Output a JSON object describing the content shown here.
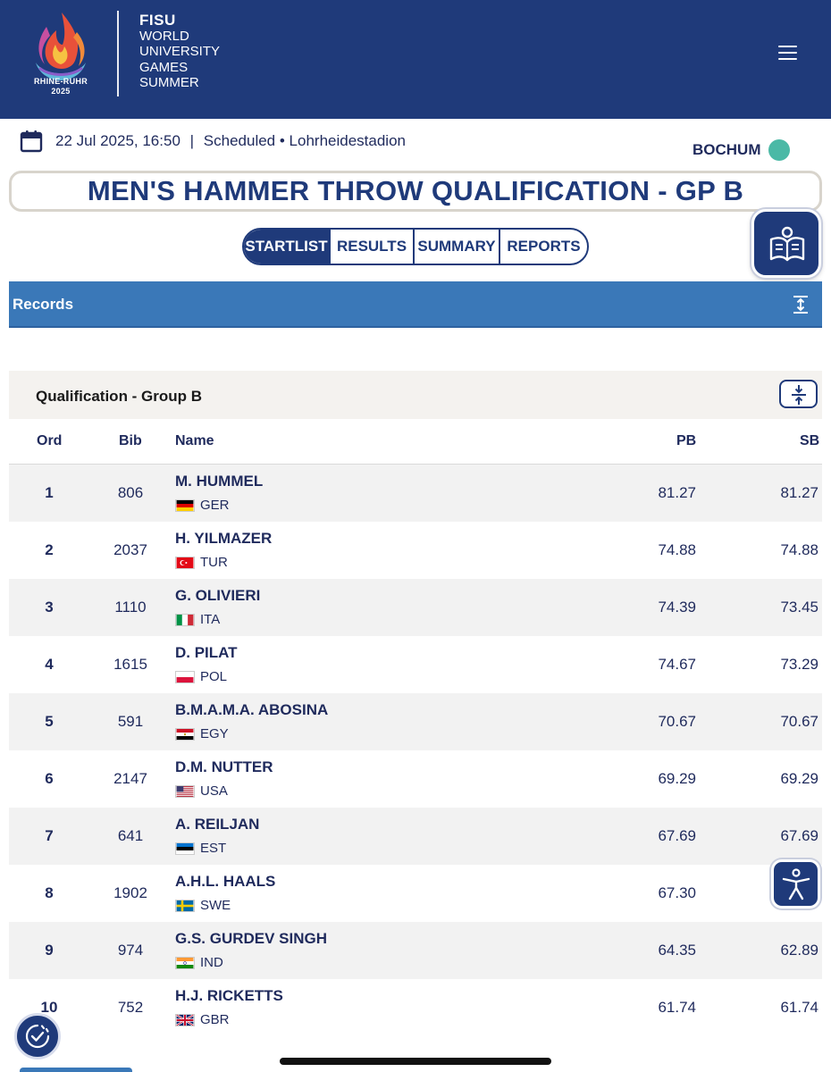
{
  "header": {
    "logo_caption_line1": "RHINE-RUHR",
    "logo_caption_line2": "2025",
    "brand_lines": [
      "FISU",
      "WORLD",
      "UNIVERSITY",
      "GAMES",
      "SUMMER"
    ],
    "menu_icon": "hamburger-menu-icon",
    "background_color": "#1f3a7a"
  },
  "event": {
    "date_time": "22 Jul 2025, 16:50",
    "separator": "|",
    "status": "Scheduled",
    "venue": "• Lohrheidestadion",
    "city": "BOCHUM",
    "city_color": "#4bb9a6",
    "title": "MEN'S HAMMER THROW QUALIFICATION - GP B"
  },
  "tabs": [
    {
      "label": "STARTLIST",
      "active": true
    },
    {
      "label": "RESULTS",
      "active": false
    },
    {
      "label": "SUMMARY",
      "active": false
    },
    {
      "label": "REPORTS",
      "active": false
    }
  ],
  "records": {
    "label": "Records",
    "bar_color": "#3a78b8"
  },
  "group": {
    "label": "Qualification - Group B"
  },
  "columns": {
    "ord": "Ord",
    "bib": "Bib",
    "name": "Name",
    "pb": "PB",
    "sb": "SB"
  },
  "rows": [
    {
      "ord": "1",
      "bib": "806",
      "name": "M. HUMMEL",
      "noc": "GER",
      "flag": "germany",
      "pb": "81.27",
      "sb": "81.27"
    },
    {
      "ord": "2",
      "bib": "2037",
      "name": "H. YILMAZER",
      "noc": "TUR",
      "flag": "turkey",
      "pb": "74.88",
      "sb": "74.88"
    },
    {
      "ord": "3",
      "bib": "1110",
      "name": "G. OLIVIERI",
      "noc": "ITA",
      "flag": "italy",
      "pb": "74.39",
      "sb": "73.45"
    },
    {
      "ord": "4",
      "bib": "1615",
      "name": "D. PILAT",
      "noc": "POL",
      "flag": "poland",
      "pb": "74.67",
      "sb": "73.29"
    },
    {
      "ord": "5",
      "bib": "591",
      "name": "B.M.A.M.A. ABOSINA",
      "noc": "EGY",
      "flag": "egypt",
      "pb": "70.67",
      "sb": "70.67"
    },
    {
      "ord": "6",
      "bib": "2147",
      "name": "D.M. NUTTER",
      "noc": "USA",
      "flag": "usa",
      "pb": "69.29",
      "sb": "69.29"
    },
    {
      "ord": "7",
      "bib": "641",
      "name": "A. REILJAN",
      "noc": "EST",
      "flag": "estonia",
      "pb": "67.69",
      "sb": "67.69"
    },
    {
      "ord": "8",
      "bib": "1902",
      "name": "A.H.L. HAALS",
      "noc": "SWE",
      "flag": "sweden",
      "pb": "67.30",
      "sb": ""
    },
    {
      "ord": "9",
      "bib": "974",
      "name": "G.S. GURDEV SINGH",
      "noc": "IND",
      "flag": "india",
      "pb": "64.35",
      "sb": "62.89"
    },
    {
      "ord": "10",
      "bib": "752",
      "name": "H.J. RICKETTS",
      "noc": "GBR",
      "flag": "great-britain",
      "pb": "61.74",
      "sb": "61.74"
    }
  ],
  "floating": {
    "reader_icon": "open-book-icon",
    "accessibility_icon": "accessibility-person-icon",
    "consent_icon": "cookie-consent-check-icon"
  }
}
